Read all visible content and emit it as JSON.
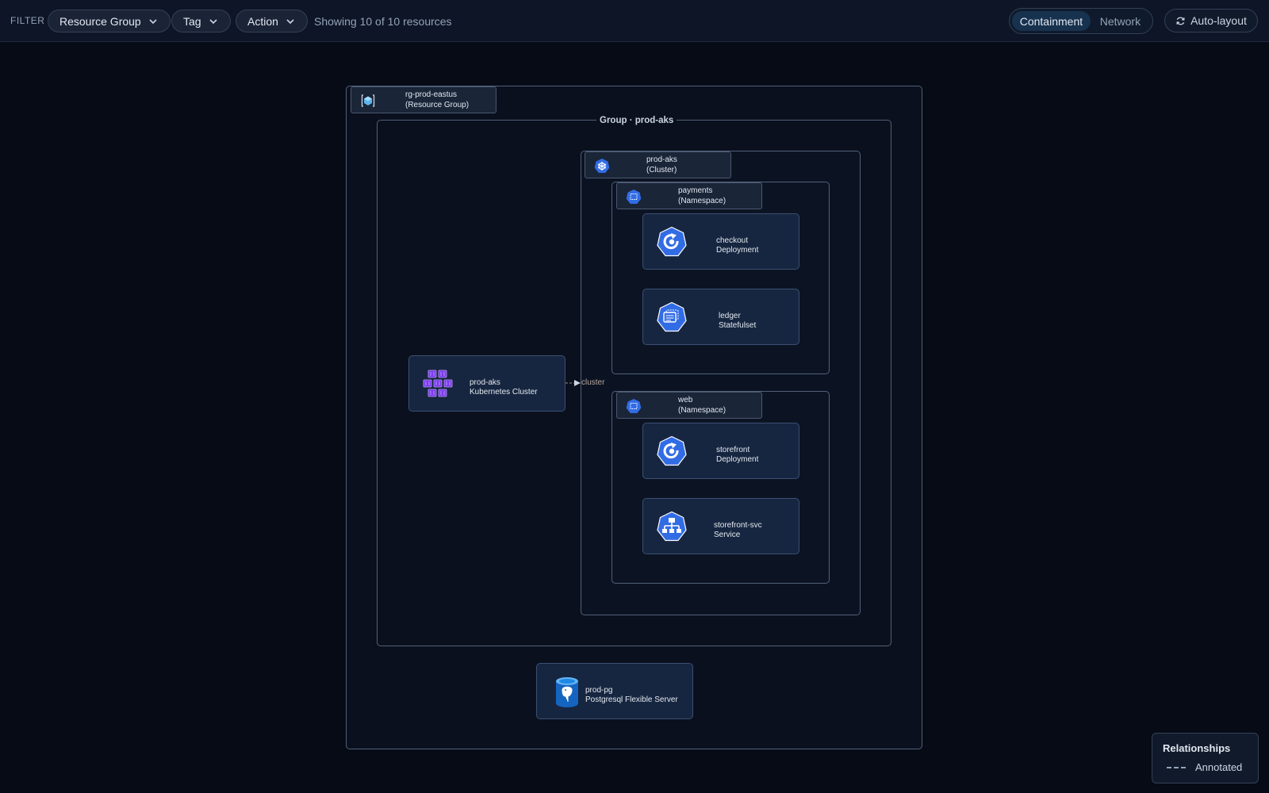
{
  "toolbar": {
    "filter_label": "FILTER",
    "filters": [
      {
        "label": "Resource Group"
      },
      {
        "label": "Tag"
      },
      {
        "label": "Action"
      }
    ],
    "count_text": "Showing 10 of 10 resources",
    "views": [
      {
        "label": "Containment",
        "active": true
      },
      {
        "label": "Network",
        "active": false
      }
    ],
    "auto_layout_label": "Auto-layout"
  },
  "diagram": {
    "resource_group": {
      "name": "rg-prod-eastus",
      "kind": "(Resource Group)",
      "icon": "resource-group-icon"
    },
    "group_title": "Group · prod-aks",
    "cluster": {
      "name": "prod-aks",
      "kind": "(Cluster)",
      "icon": "kubernetes-icon"
    },
    "namespaces": [
      {
        "name": "payments",
        "kind": "(Namespace)",
        "icon": "namespace-icon"
      },
      {
        "name": "web",
        "kind": "(Namespace)",
        "icon": "namespace-icon"
      }
    ],
    "nodes": [
      {
        "name": "checkout",
        "kind": "Deployment",
        "icon": "deployment-icon"
      },
      {
        "name": "ledger",
        "kind": "Statefulset",
        "icon": "statefulset-icon"
      },
      {
        "name": "storefront",
        "kind": "Deployment",
        "icon": "deployment-icon"
      },
      {
        "name": "storefront-svc",
        "kind": "Service",
        "icon": "service-icon"
      },
      {
        "name": "prod-aks",
        "kind": "Kubernetes Cluster",
        "icon": "aks-cluster-icon"
      },
      {
        "name": "prod-pg",
        "kind": "Postgresql Flexible Server",
        "icon": "postgresql-icon"
      }
    ],
    "edges": [
      {
        "from": "prod-aks",
        "to": "prod-aks",
        "label": "cluster"
      }
    ]
  },
  "legend": {
    "title": "Relationships",
    "items": [
      {
        "label": "Annotated",
        "style": "dashed"
      }
    ]
  },
  "colors": {
    "background": "#060b16",
    "k8s_blue": "#326ce5",
    "aks_purple": "#7c3aed",
    "postgres_blue": "#1e88e5"
  }
}
